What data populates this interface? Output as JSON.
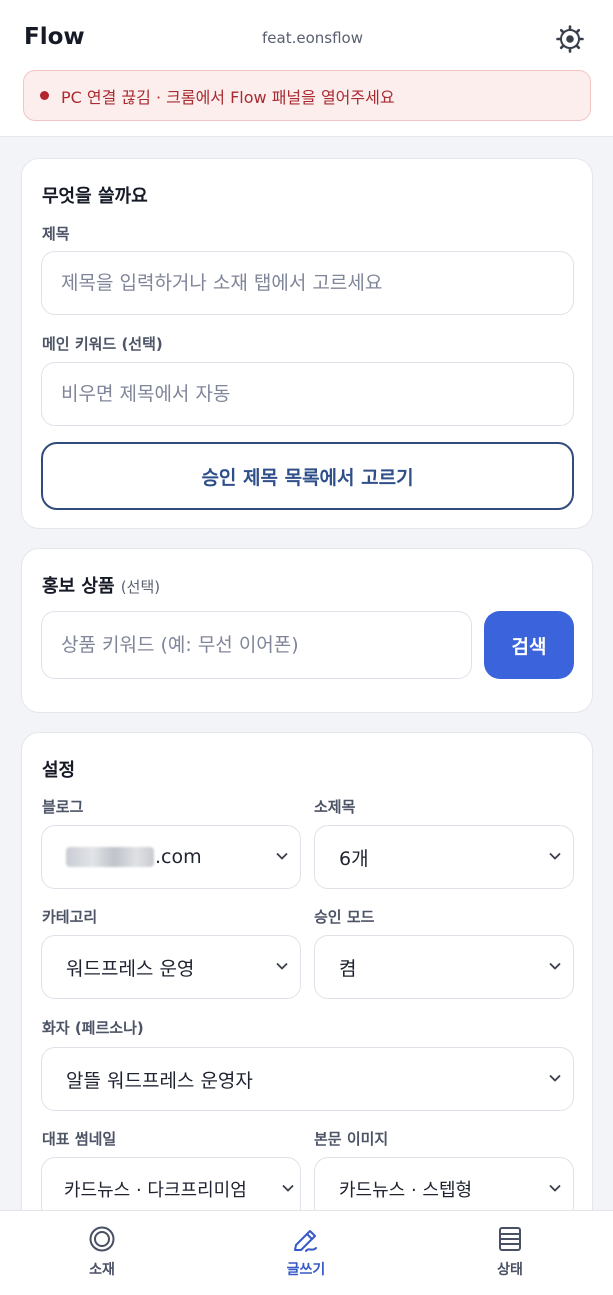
{
  "header": {
    "title": "Flow",
    "account": "feat.eonsflow",
    "settings_icon": "gear-icon"
  },
  "alert": {
    "text": "PC 연결 끊김 · 크롬에서 Flow 패널을 열어주세요",
    "color": "#b3262e"
  },
  "compose": {
    "title": "무엇을 쓸까요",
    "title_label": "제목",
    "title_placeholder": "제목을 입력하거나 소재 탭에서 고르세요",
    "keyword_label": "메인 키워드 (선택)",
    "keyword_placeholder": "비우면 제목에서 자동",
    "pick_button": "승인 제목 목록에서 고르기"
  },
  "product": {
    "title": "홍보 상품",
    "title_suffix": "(선택)",
    "search_placeholder": "상품 키워드 (예: 무선 이어폰)",
    "search_button": "검색",
    "accent": "#3b63db"
  },
  "settings": {
    "title": "설정",
    "blog_label": "블로그",
    "blog_value": ".com",
    "subheading_label": "소제목",
    "subheading_value": "6개",
    "category_label": "카테고리",
    "category_value": "워드프레스 운영",
    "approval_label": "승인 모드",
    "approval_value": "켬",
    "persona_label": "화자 (페르소나)",
    "persona_value": "알뜰 워드프레스 운영자",
    "thumbnail_label": "대표 썸네일",
    "thumbnail_value": "카드뉴스 · 다크프리미엄",
    "body_image_label": "본문 이미지",
    "body_image_value": "카드뉴스 · 스텝형"
  },
  "nav": {
    "items": [
      {
        "label": "소재",
        "icon": "target-icon"
      },
      {
        "label": "글쓰기",
        "icon": "pencil-icon",
        "active": true
      },
      {
        "label": "상태",
        "icon": "list-icon"
      }
    ]
  }
}
